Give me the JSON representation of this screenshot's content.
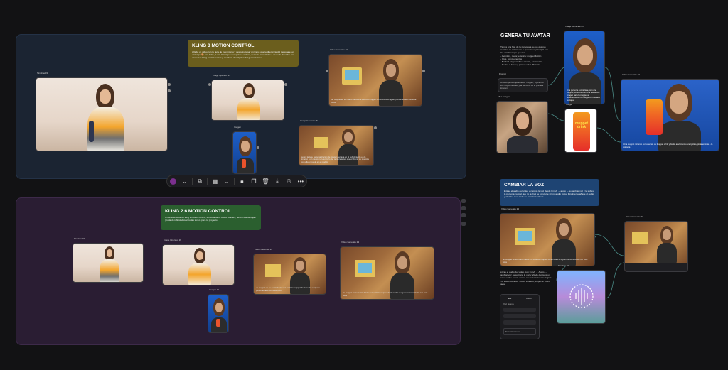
{
  "groups": {
    "kling3": {
      "note_title": "KLING 3 MOTION CONTROL",
      "note_body": "Añade un vídeo con tu guía de movimiento y después pasar un frame que te diferencie del personaje, en varios pn 🎨 y tu bebe, a ver, la imagen que quieres animar, después conéctalos a un node de vídeo con el modelo Kling control motion y diseña la descripcion del general video"
    },
    "kling26": {
      "note_title": "KLING 2.6 MOTION CONTROL",
      "note_body": "un tanto anterior de kling 2 motion control, funciona de la misma manera, tenem sus ventajas | cada de infinidad cual pudas tenem para tu proyecto"
    }
  },
  "nodes": {
    "timeline_a": "Timeline #1",
    "image_gen_a": "Image Operator #1",
    "image_a": "Imagen",
    "video_gen_a": "Video Generate #1",
    "image_gen_b": "Image Generate #2",
    "timeline_b": "Timeline #1",
    "image_gen_c": "Image Operator #2",
    "image_b": "Imagen #1",
    "video_gen_b": "Video Generate #2",
    "video_gen_c": "Video Generate #3",
    "file_a": "Files Imagen",
    "text_a": "Prompt",
    "timeline_c": "Timeline #4",
    "image_c": "Image",
    "image_gen_d": "Image Generate #1",
    "video_gen_d": "Video Generate #1",
    "video_gen_e": "Video Generate #2",
    "audio_a": "Timeline #3"
  },
  "captions": {
    "video_a": "un muppet en su cuarto hacia una estética muppet frente todos a siguen personalizado con esta fotos",
    "video_b": "sobre la ruta, personalización de imagen seriada en el subicimiento en la imagen a un muppet el escritorio del personaje por que el cliente se muestra con ella un suelo en el modelo",
    "video_c": "un muppet en su cuarto hacia una estética muppet frente todos a siguen personalizado con esta fotos",
    "video_d": "un muppet en su cuarto hacia una estética muppet frente todos a siguen personalizado con esta fotos",
    "image_d": "Una persona conviértete, con una muppet, convertido en una referencia imagen para la muppet a posteriormente un muppet en cuidado y su capa"
  },
  "avatar": {
    "title": "GENERA TU AVATAR",
    "body": "Tienes una foto de la persona a la que quieres avatizar no solamente a generar un principal con las variables que quieres:\n- Aventura, mejor, estética: muppet ficción\n- Ojos, complementos\n- Barba? Sí!, pestañas, cicatriz, bastoncillo, ...\n- Define el fondo y pon un color diferente",
    "prompt_text": "crea un personaje estético muppet, siguiendo los rasgos faciales y la persona de la primera imagen",
    "result_text": "Una muppet mirando con una lata de Muppet drink y fondo azul intenso energético, pinta en más a la cámara"
  },
  "voice": {
    "title": "CAMBIAR LA VOZ",
    "body": "Extrae el audio del vídeo y cambia la voz desde Inmyfi → audio → a cambiar voz y le subes la persona (suma) que no la final se convierte sin mi audio voice: Finalmente añade al audio y al video a un node de combinar videos",
    "desc_text": "Extrae el audio del vídeo, con Inmyfi → Audio → cambiar voz, selecciona la voz y añade después un nuevo vídeo con la voz en ese estudio la voz elegida y tu audio extraído. Subiré el audio, empecen pues nada.",
    "tabs": [
      "Voz",
      "Audio"
    ],
    "field_label": "Voz Nueva",
    "select_value": "Seleccionar voz"
  },
  "toolbar": {
    "color": "#7b2f8e",
    "icons": [
      "color-swatch",
      "copy-icon",
      "layout-icon",
      "chevron-down-icon",
      "lock-icon",
      "duplicate-icon",
      "delete-icon",
      "download-icon",
      "network-icon",
      "more-icon"
    ]
  },
  "can_text": "muppet drink"
}
